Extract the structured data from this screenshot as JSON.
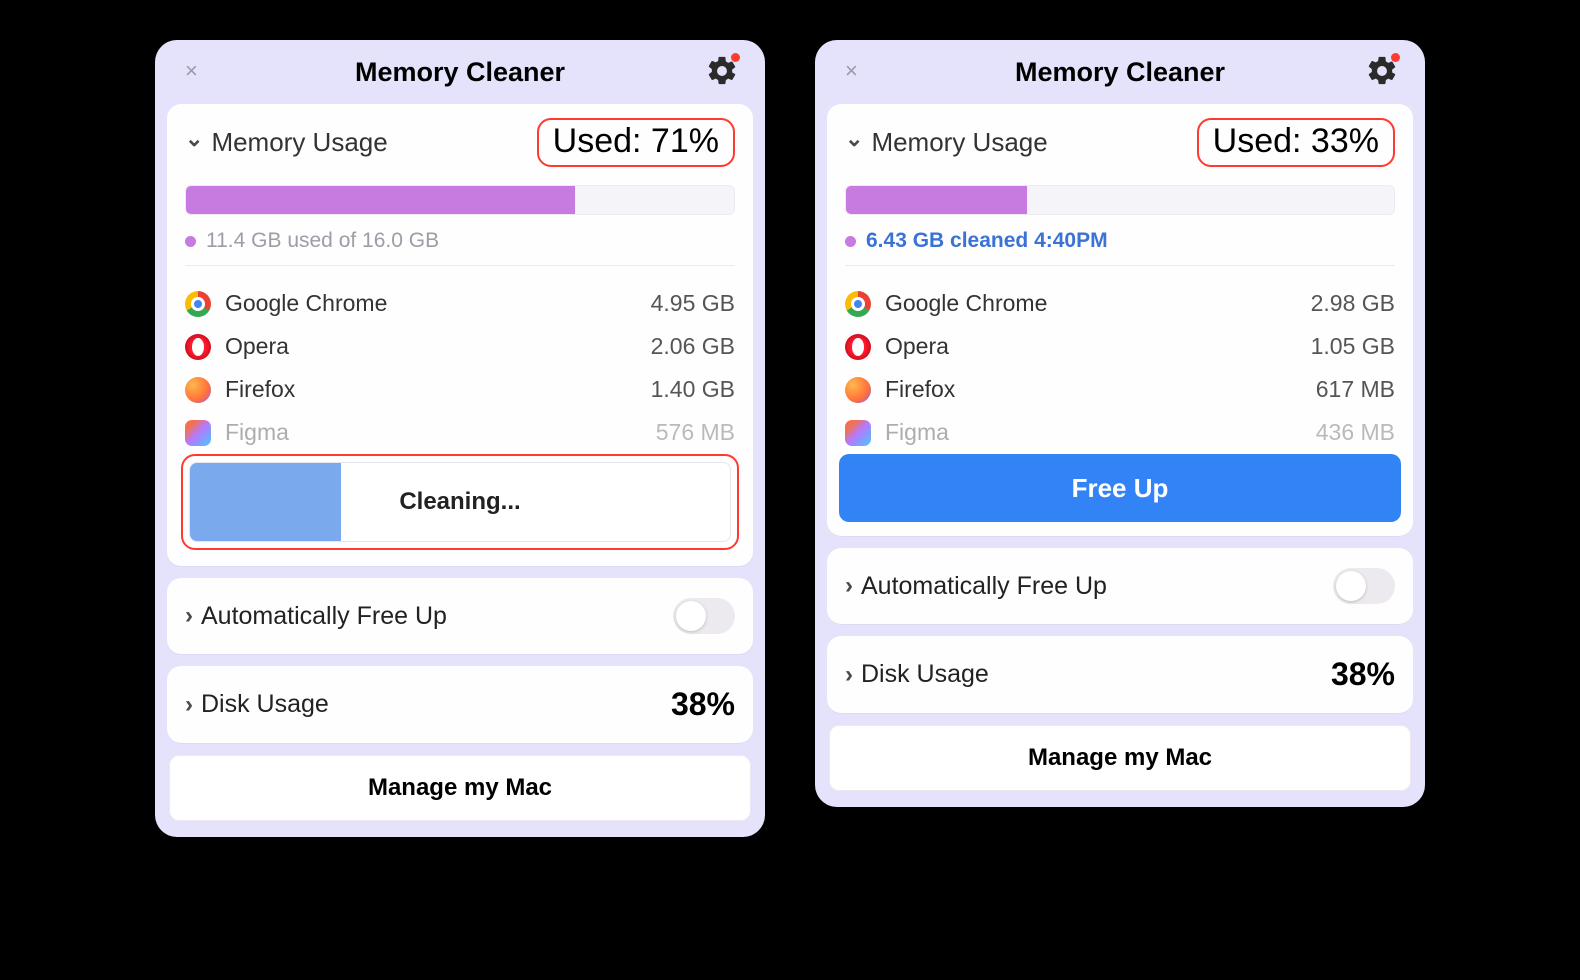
{
  "left": {
    "title": "Memory Cleaner",
    "memory": {
      "section_title": "Memory Usage",
      "used_label": "Used: 71%",
      "used_percent": 71,
      "status_text": "11.4 GB used of 16.0 GB",
      "status_style": "gray",
      "apps": [
        {
          "name": "Google Chrome",
          "size": "4.95 GB",
          "icon": "chrome"
        },
        {
          "name": "Opera",
          "size": "2.06 GB",
          "icon": "opera"
        },
        {
          "name": "Firefox",
          "size": "1.40 GB",
          "icon": "firefox"
        },
        {
          "name": "Figma",
          "size": "576 MB",
          "icon": "figma",
          "fade": true
        }
      ],
      "action": {
        "mode": "cleaning",
        "label": "Cleaning...",
        "progress_percent": 28
      }
    },
    "auto_free_up": {
      "title": "Automatically Free Up",
      "enabled": false
    },
    "disk": {
      "title": "Disk Usage",
      "percent_label": "38%"
    },
    "manage_label": "Manage my Mac"
  },
  "right": {
    "title": "Memory Cleaner",
    "memory": {
      "section_title": "Memory Usage",
      "used_label": "Used: 33%",
      "used_percent": 33,
      "status_text": "6.43 GB cleaned 4:40PM",
      "status_style": "blue",
      "apps": [
        {
          "name": "Google Chrome",
          "size": "2.98 GB",
          "icon": "chrome"
        },
        {
          "name": "Opera",
          "size": "1.05 GB",
          "icon": "opera"
        },
        {
          "name": "Firefox",
          "size": "617 MB",
          "icon": "firefox"
        },
        {
          "name": "Figma",
          "size": "436 MB",
          "icon": "figma",
          "fade": true
        }
      ],
      "action": {
        "mode": "button",
        "label": "Free Up"
      }
    },
    "auto_free_up": {
      "title": "Automatically Free Up",
      "enabled": false
    },
    "disk": {
      "title": "Disk Usage",
      "percent_label": "38%"
    },
    "manage_label": "Manage my Mac"
  }
}
